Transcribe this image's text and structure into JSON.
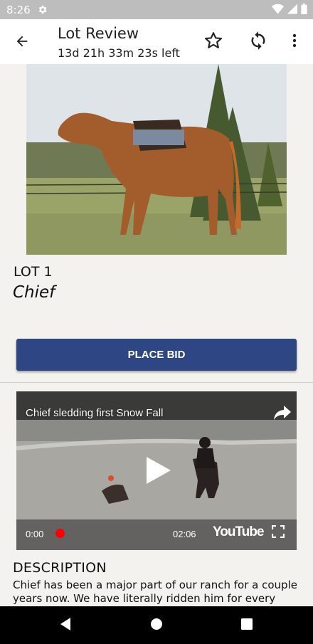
{
  "status_bar": {
    "time": "8:26",
    "icons": [
      "gear-icon",
      "wifi-icon",
      "signal-icon",
      "battery-icon"
    ]
  },
  "app_bar": {
    "title": "Lot Review",
    "subtitle": "13d 21h 33m 23s left",
    "icons": [
      "back-arrow-icon",
      "star-outline-icon",
      "refresh-icon",
      "more-vert-icon"
    ]
  },
  "lot": {
    "number": "LOT 1",
    "name": "Chief",
    "photo_description": "Chestnut horse with saddle standing beside an evergreen tree"
  },
  "bid_button": {
    "label": "PLACE BID",
    "color": "#2e4683"
  },
  "video": {
    "title": "Chief sledding first Snow Fall",
    "current_time": "0:00",
    "duration": "02:06",
    "logo": "YouTube",
    "progress_color": "#ff0000"
  },
  "description": {
    "heading": "DESCRIPTION",
    "text": "Chief has been a major part of our ranch for a couple years now. We have literally ridden him for every aspect"
  },
  "nav_bar": {
    "icons": [
      "back-triangle-icon",
      "home-circle-icon",
      "recents-square-icon"
    ]
  }
}
